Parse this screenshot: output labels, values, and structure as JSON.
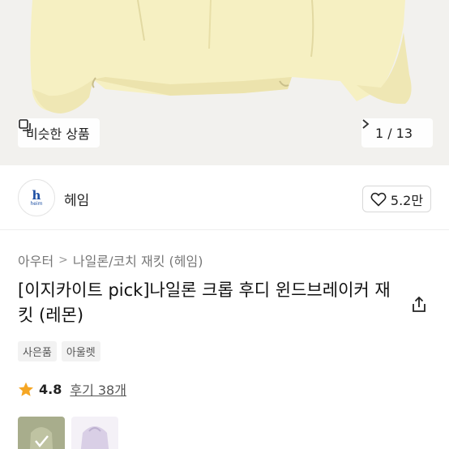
{
  "hero": {
    "similar_label": "비슷한 상품",
    "similar_icon": "duplicate-icon",
    "counter": "1 / 13",
    "next_icon": "chevron-right-icon",
    "garment_color": "#f6f0c2"
  },
  "brand": {
    "logo_mark": "h",
    "logo_sub": "heim",
    "name": "헤임",
    "likes": "5.2만",
    "like_icon": "heart-icon"
  },
  "breadcrumb": {
    "items": [
      "아우터",
      "나일론/코치 재킷 (헤임)"
    ],
    "separator": ">"
  },
  "product": {
    "title": "[이지카이트 pick]나일론 크롭 후디 윈드브레이커 재킷 (레몬)",
    "share_icon": "share-icon"
  },
  "tags": [
    "사은품",
    "아울렛"
  ],
  "rating": {
    "star_icon": "star-icon",
    "score": "4.8",
    "reviews": "후기 38개",
    "star_color": "#f5a623"
  },
  "thumbnails": [
    {
      "color": "#a8ad8c",
      "selected": true
    },
    {
      "color": "#d9cfe6",
      "selected": false
    }
  ]
}
